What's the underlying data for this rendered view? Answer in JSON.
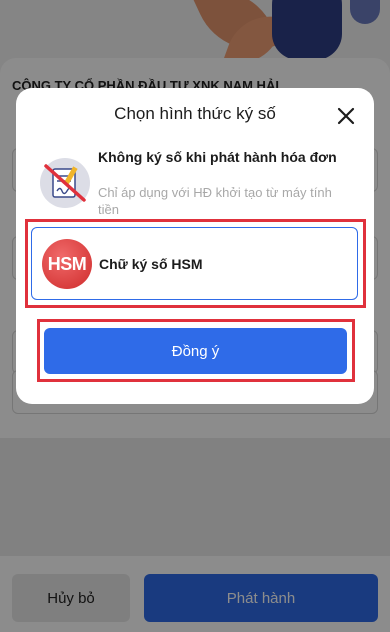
{
  "background": {
    "company_name": "CÔNG TY CỔ PHẦN ĐẦU TƯ XNK NAM HẢI",
    "cancel_label": "Hủy bỏ",
    "publish_label": "Phát hành"
  },
  "modal": {
    "title": "Chọn hình thức ký số",
    "options": [
      {
        "title": "Không ký số khi phát hành hóa đơn",
        "subtitle": "Chỉ áp dụng với HĐ khởi tạo từ máy tính tiền",
        "icon": "no-signature-icon"
      },
      {
        "title": "Chữ ký số HSM",
        "badge": "HSM",
        "icon": "hsm-badge-icon",
        "selected": true
      }
    ],
    "confirm_label": "Đồng ý"
  },
  "colors": {
    "primary": "#2f6be8",
    "highlight": "#e0313c",
    "hsm_badge": "#d83838",
    "muted_text": "#a8a8a8"
  }
}
